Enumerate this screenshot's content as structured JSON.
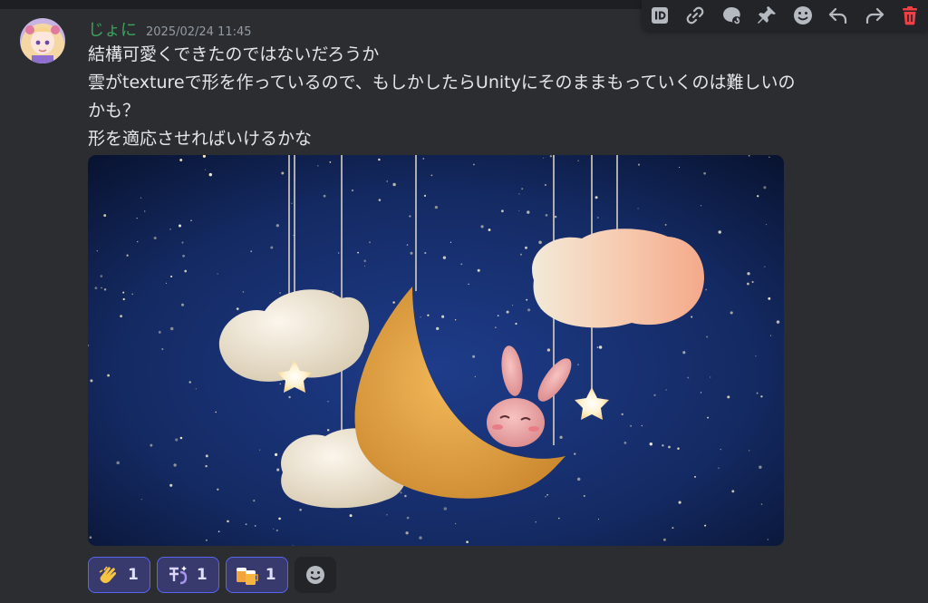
{
  "message": {
    "username": "じょに",
    "timestamp": "2025/02/24 11:45",
    "lines": [
      "結構可愛くできたのではないだろうか",
      "雲がtextureで形を作っているので、もしかしたらUnityにそのままもっていくのは難しいの",
      "かも？",
      "形を適応させればいけるかな"
    ]
  },
  "attachment": {
    "icon": "image-attachment",
    "colors": {
      "sky": "#0f2150",
      "moon": "#e3a548",
      "cloud": "#efe7d6",
      "cloud_peach": "#f3b79a",
      "bunny": "#f0a7a8"
    }
  },
  "toolbar": {
    "icons": [
      "copy-id-icon",
      "copy-link-icon",
      "thread-icon",
      "pin-icon",
      "add-reaction-icon",
      "reply-icon",
      "forward-icon",
      "delete-icon"
    ],
    "accent_delete": "#f23f43"
  },
  "reactions": [
    {
      "emoji": "clapping-hands-icon",
      "count": "1"
    },
    {
      "emoji": "custom-sparkle-emoji-icon",
      "count": "1"
    },
    {
      "emoji": "beer-mugs-icon",
      "count": "1"
    }
  ],
  "colors": {
    "background": "#2b2d31",
    "username": "#3ba55c",
    "reaction_border": "#5865f2"
  }
}
